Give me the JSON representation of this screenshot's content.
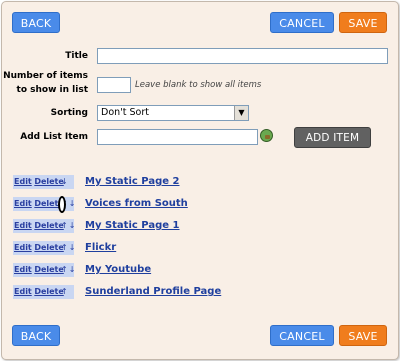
{
  "toolbar_top": {
    "back_label": "BACK",
    "cancel_label": "CANCEL",
    "save_label": "SAVE"
  },
  "form": {
    "title_label": "Title",
    "title_value": "",
    "items_label_line1": "Number of items",
    "items_label_line2": "to show in list",
    "items_value": "",
    "items_hint": "Leave blank to show all items",
    "sorting_label": "Sorting",
    "sorting_value": "Don't Sort",
    "add_item_label": "Add List Item",
    "add_item_value": "",
    "add_item_button": "ADD ITEM"
  },
  "list": {
    "edit_label": "Edit",
    "delete_label": "Delete",
    "items": [
      {
        "title": "My Static Page 2",
        "arrows": "↓"
      },
      {
        "title": "Voices from South",
        "arrows": "↑↓"
      },
      {
        "title": "My Static Page 1",
        "arrows": "↑↓"
      },
      {
        "title": "Flickr",
        "arrows": "↑↓"
      },
      {
        "title": "My Youtube",
        "arrows": "↑↓"
      },
      {
        "title": "Sunderland Profile Page",
        "arrows": "↑"
      }
    ]
  },
  "toolbar_bottom": {
    "back_label": "BACK",
    "cancel_label": "CANCEL",
    "save_label": "SAVE"
  },
  "colors": {
    "blue_button": "#4a8be9",
    "orange_button": "#f07d1d",
    "panel_bg": "#f9efe6",
    "link": "#1f3f9e"
  }
}
